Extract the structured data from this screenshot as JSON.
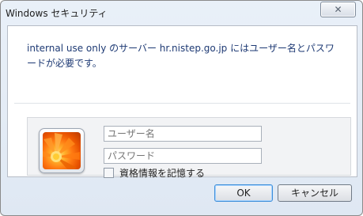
{
  "window": {
    "title": "Windows セキュリティ",
    "close_symbol": "✕"
  },
  "message": "internal use only のサーバー hr.nistep.go.jp にはユーザー名とパスワードが必要です。",
  "credentials": {
    "username_placeholder": "ユーザー名",
    "password_placeholder": "パスワード",
    "remember_label": "資格情報を記憶する",
    "remember_checked": false
  },
  "buttons": {
    "ok_label": "OK",
    "cancel_label": "キャンセル"
  },
  "colors": {
    "message_text": "#1e3a74",
    "dialog_bg": "#dfe8f3",
    "default_button_border": "#3d8ed9"
  },
  "icons": {
    "avatar": "orange-flower-user-tile",
    "close": "close-icon"
  }
}
